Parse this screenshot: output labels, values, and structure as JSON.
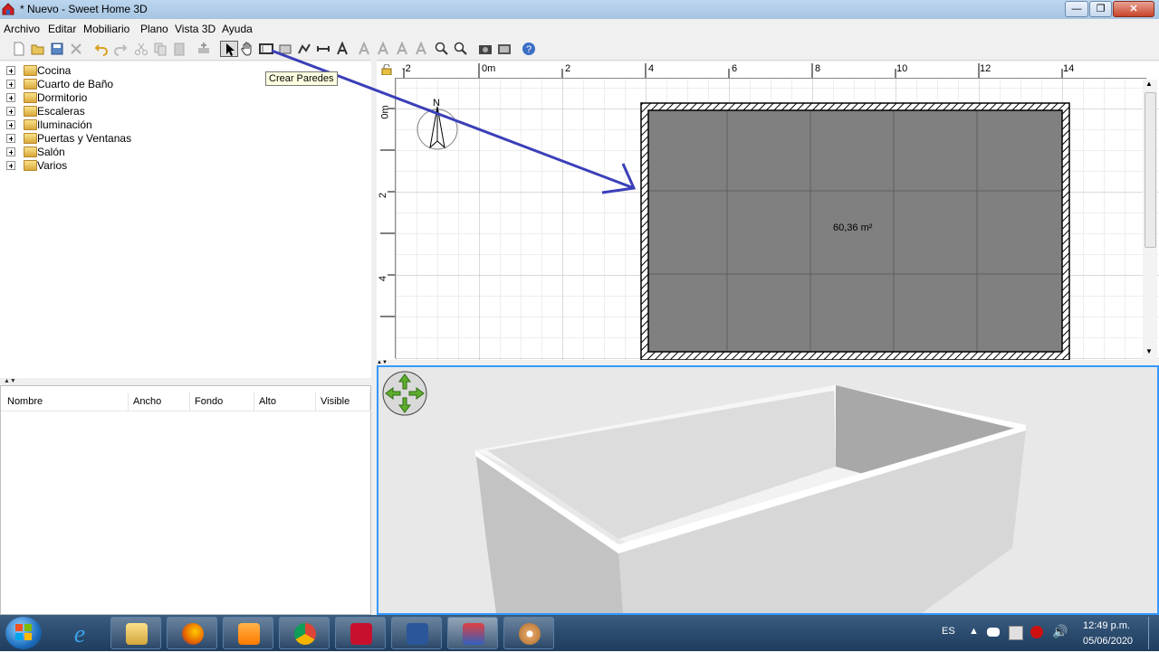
{
  "window": {
    "title": "* Nuevo - Sweet Home 3D",
    "minimize": "—",
    "maximize": "❐",
    "close": "✕"
  },
  "menu": [
    "Archivo",
    "Editar",
    "Mobiliario",
    "Plano",
    "Vista 3D",
    "Ayuda"
  ],
  "tooltip": "Crear Paredes",
  "catalog": {
    "categories": [
      "Cocina",
      "Cuarto de Baño",
      "Dormitorio",
      "Escaleras",
      "Iluminación",
      "Puertas y Ventanas",
      "Salón",
      "Varios"
    ]
  },
  "furniture_table": {
    "columns": [
      "Nombre",
      "Ancho",
      "Fondo",
      "Alto",
      "Visible"
    ]
  },
  "plan": {
    "ruler_x": [
      "-2",
      "0m",
      "2",
      "4",
      "6",
      "8",
      "10",
      "12",
      "14"
    ],
    "ruler_y": [
      "0m",
      "2",
      "4"
    ],
    "compass_label": "N",
    "room_area": "60,36 m²"
  },
  "colors": {
    "annotation_arrow": "#3a3fb8",
    "room_fill": "#808080",
    "view3d_border": "#3399ff"
  },
  "taskbar": {
    "apps": [
      "internet-explorer",
      "file-explorer",
      "firefox",
      "media-player",
      "chrome",
      "acrobat",
      "word",
      "sweet-home-3d",
      "paint"
    ],
    "language": "ES",
    "time": "12:49 p.m.",
    "date": "05/06/2020"
  }
}
